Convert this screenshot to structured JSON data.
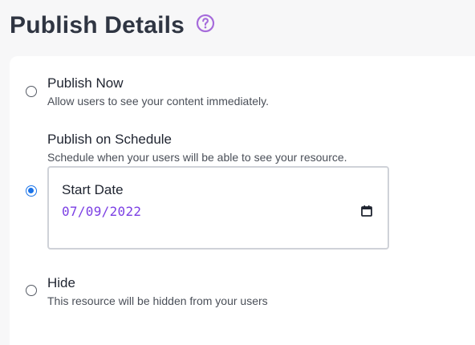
{
  "header": {
    "title": "Publish Details",
    "help_icon": "help-circle-icon",
    "accent": "#a66bdb"
  },
  "options": [
    {
      "label": "Publish Now",
      "description": "Allow users to see your content immediately.",
      "selected": false
    },
    {
      "label": "Publish on Schedule",
      "description": "Schedule when your users will be able to see your resource.",
      "selected": true
    },
    {
      "label": "Hide",
      "description": "This resource will be hidden from your users",
      "selected": false
    }
  ],
  "schedule": {
    "start_date_label": "Start Date",
    "start_date_value": "07/09/2022",
    "calendar_icon": "calendar-icon",
    "value_color": "#7b3fe4"
  },
  "colors": {
    "radio_selected": "#1a73e8",
    "title": "#2f3542",
    "background": "#f7f7f8"
  }
}
